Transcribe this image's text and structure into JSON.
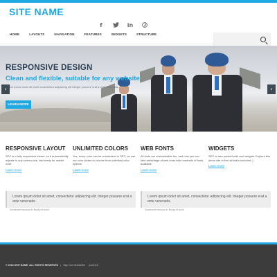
{
  "header": {
    "site_name": "SITE NAME",
    "social": [
      "f",
      "t",
      "in",
      "p"
    ]
  },
  "nav": {
    "items": [
      "HOME",
      "LAYOUTS",
      "NAVIGATION",
      "FEATURES",
      "WIDGETS",
      "STRUCTURE"
    ]
  },
  "hero": {
    "title": "RESPONSIVE DESIGN",
    "subtitle": "Clean and flexible, suitable for any website",
    "text": "Lorem ipsum dolor sit amet consectetur adipiscing elit integer posuere erat a ante venenatis",
    "button": "LEARN MORE",
    "prev": "‹",
    "next": "›"
  },
  "features": [
    {
      "title": "RESPONSIVE LAYOUT",
      "text": "SPC is a fully responsive theme, so it automatically adjusts to any screen size, fast ready for mobile now!",
      "link": "Learn more"
    },
    {
      "title": "UNLIMITED COLORS",
      "text": "Yes, every color can be customized in SPC, so use our color picker to choose from unlimited color options.",
      "link": "Learn more"
    },
    {
      "title": "WEB FONTS",
      "text": "All fonts are customizable too, and now you can take advantage of web fonts with hundreds of fonts available.",
      "link": "Learn more"
    },
    {
      "title": "WIDGETS",
      "text": "SPC is also packed with cool widgets. Explore this demo site to find all that's included :)",
      "link": "Learn more"
    }
  ],
  "quotes": [
    {
      "text": "Lorem ipsum dolor sit amet, consectetur adipiscing elit. Integer posuere erat a ante venenatis.",
      "cite": "Someone famous in Body of work"
    },
    {
      "text": "Lorem ipsum dolor sit amet, consectetur adipiscing elit. Integer posuere erat a ante venenatis.",
      "cite": "Someone famous in Body of work"
    }
  ],
  "footer": {
    "copyright": "© 2015 SITE NAME. ALL RIGHTS RESERVED",
    "links": "Sign Out   Newsletter",
    "credit": "powered"
  },
  "colors": {
    "accent": "#1fa8e1",
    "hero_title": "#2a3e55",
    "footer_bg": "#3c3c3c"
  }
}
